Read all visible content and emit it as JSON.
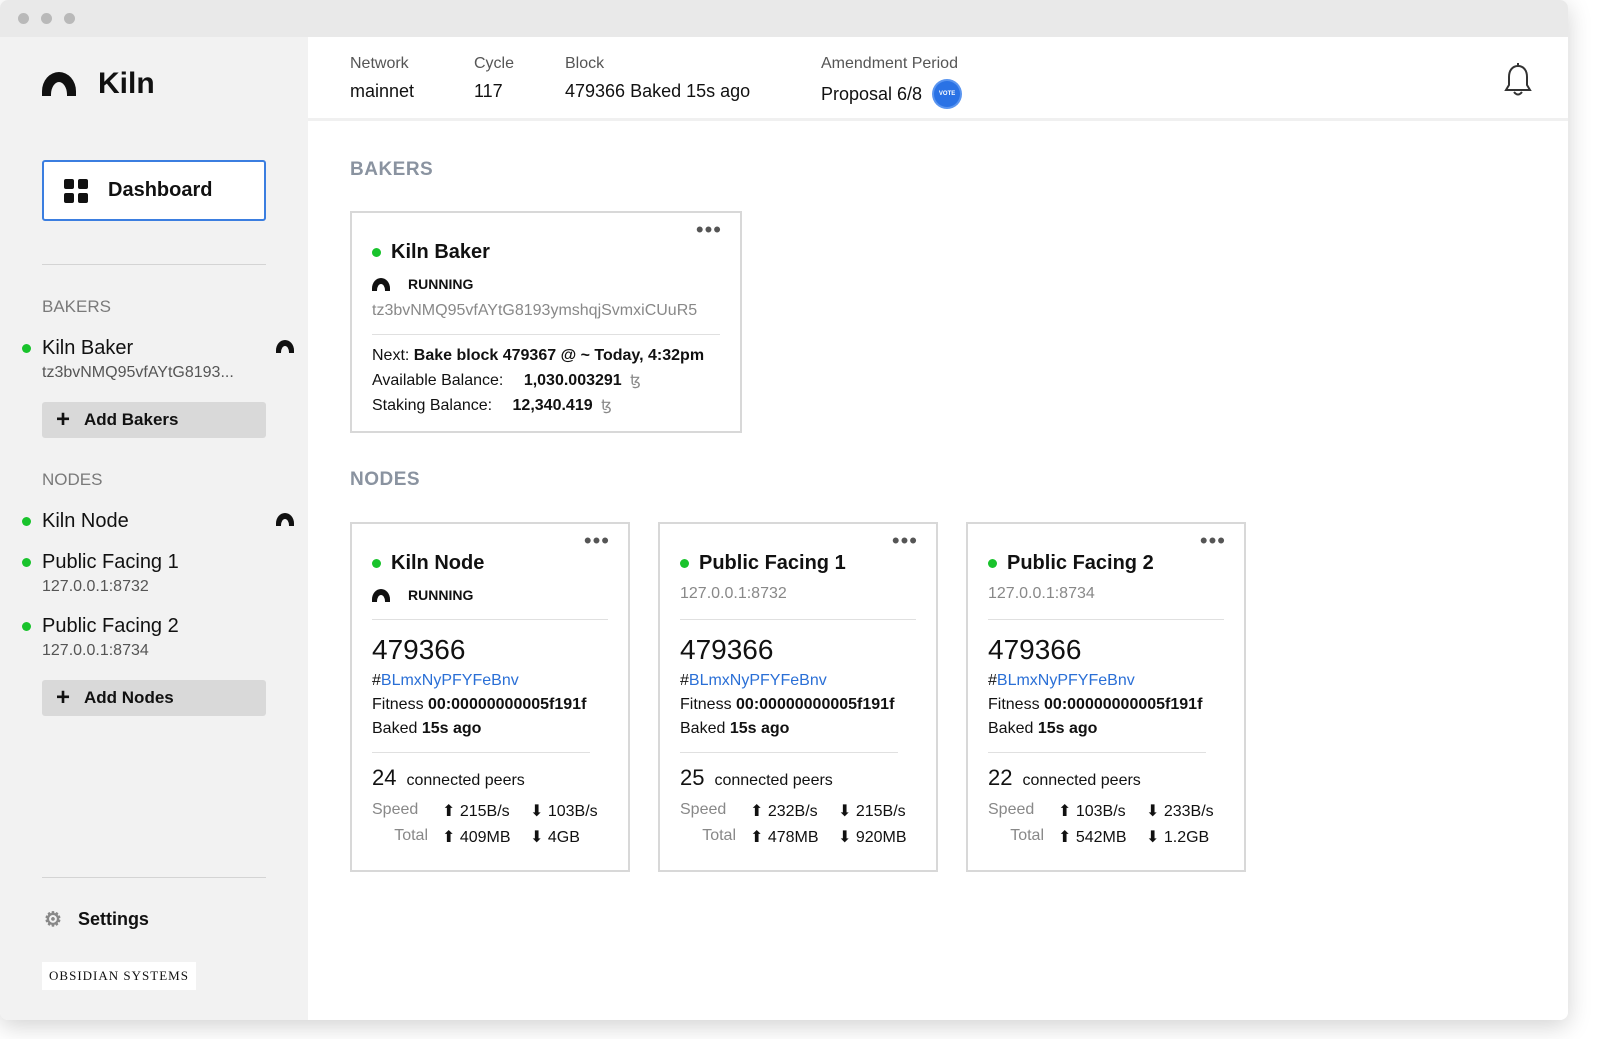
{
  "app": {
    "title": "Kiln"
  },
  "sidebar": {
    "dashboard_label": "Dashboard",
    "bakers_label": "BAKERS",
    "bakers": [
      {
        "name": "Kiln Baker",
        "address": "tz3bvNMQ95vfAYtG8193..."
      }
    ],
    "add_bakers_label": "Add Bakers",
    "nodes_label": "NODES",
    "nodes": [
      {
        "name": "Kiln Node",
        "address": ""
      },
      {
        "name": "Public Facing 1",
        "address": "127.0.0.1:8732"
      },
      {
        "name": "Public Facing 2",
        "address": "127.0.0.1:8734"
      }
    ],
    "add_nodes_label": "Add Nodes",
    "settings_label": "Settings",
    "footer_brand": "OBSIDIAN SYSTEMS"
  },
  "header": {
    "network_label": "Network",
    "network_value": "mainnet",
    "cycle_label": "Cycle",
    "cycle_value": "117",
    "block_label": "Block",
    "block_value": "479366 Baked 15s ago",
    "amendment_label": "Amendment Period",
    "amendment_value": "Proposal 6/8",
    "vote_badge": "VOTE"
  },
  "main": {
    "bakers_section": "BAKERS",
    "nodes_section": "NODES",
    "baker_card": {
      "name": "Kiln Baker",
      "status": "RUNNING",
      "address": "tz3bvNMQ95vfAYtG8193ymshqjSvmxiCUuR5",
      "next_label": "Next:",
      "next_value": "Bake block 479367 @ ~ Today, 4:32pm",
      "available_label": "Available Balance:",
      "available_value": "1,030.003291",
      "staking_label": "Staking Balance:",
      "staking_value": "12,340.419",
      "currency": "ꜩ"
    },
    "node_cards": [
      {
        "name": "Kiln Node",
        "status": "RUNNING",
        "address": "",
        "block": "479366",
        "hash_prefix": "#",
        "hash": "BLmxNyPFYFeBnv",
        "fitness_label": "Fitness",
        "fitness": "00:00000000005f191f",
        "baked_label": "Baked",
        "baked": "15s ago",
        "peers": "24",
        "peers_label": "connected peers",
        "speed_label": "Speed",
        "speed_up": "215B/s",
        "speed_down": "103B/s",
        "total_label": "Total",
        "total_up": "409MB",
        "total_down": "4GB"
      },
      {
        "name": "Public Facing 1",
        "status": "",
        "address": "127.0.0.1:8732",
        "block": "479366",
        "hash_prefix": "#",
        "hash": "BLmxNyPFYFeBnv",
        "fitness_label": "Fitness",
        "fitness": "00:00000000005f191f",
        "baked_label": "Baked",
        "baked": "15s ago",
        "peers": "25",
        "peers_label": "connected peers",
        "speed_label": "Speed",
        "speed_up": "232B/s",
        "speed_down": "215B/s",
        "total_label": "Total",
        "total_up": "478MB",
        "total_down": "920MB"
      },
      {
        "name": "Public Facing 2",
        "status": "",
        "address": "127.0.0.1:8734",
        "block": "479366",
        "hash_prefix": "#",
        "hash": "BLmxNyPFYFeBnv",
        "fitness_label": "Fitness",
        "fitness": "00:00000000005f191f",
        "baked_label": "Baked",
        "baked": "15s ago",
        "peers": "22",
        "peers_label": "connected peers",
        "speed_label": "Speed",
        "speed_up": "103B/s",
        "speed_down": "233B/s",
        "total_label": "Total",
        "total_up": "542MB",
        "total_down": "1.2GB"
      }
    ]
  },
  "colors": {
    "accent": "#3b7ee0",
    "status_green": "#19c32c",
    "link": "#2a6fd6"
  },
  "icons": [
    "kiln-arch-icon",
    "dashboard-grid-icon",
    "plus-icon",
    "gear-icon",
    "bell-icon",
    "vote-badge-icon",
    "more-dots-icon",
    "arrow-up-icon",
    "arrow-down-icon"
  ]
}
